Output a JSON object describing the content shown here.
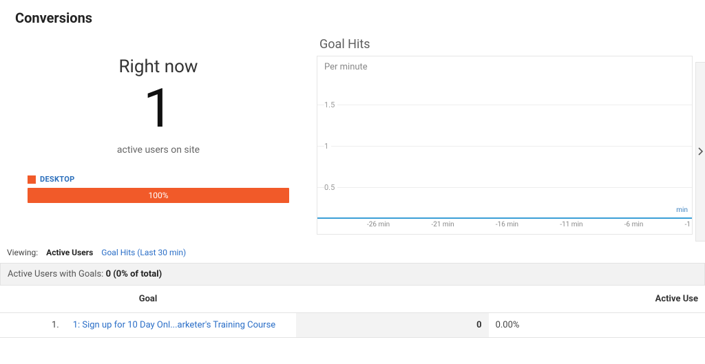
{
  "header": {
    "title": "Conversions"
  },
  "realtime": {
    "heading": "Right now",
    "count": "1",
    "subtitle": "active users on site",
    "device_label": "DESKTOP",
    "device_bar_pct": "100%"
  },
  "chart": {
    "title": "Goal Hits",
    "unit": "Per minute",
    "axis_unit": "min"
  },
  "chart_data": {
    "type": "bar",
    "title": "Goal Hits — Per minute",
    "xlabel": "min",
    "ylabel": "",
    "ylim": [
      0,
      2
    ],
    "yticks": [
      0.5,
      1.0,
      1.5
    ],
    "categories": [
      "-26 min",
      "-21 min",
      "-16 min",
      "-11 min",
      "-6 min",
      "-1"
    ],
    "values": [
      0,
      0,
      0,
      0,
      0,
      0
    ]
  },
  "modes": {
    "label": "Viewing:",
    "active": "Active Users",
    "other": "Goal Hits (Last 30 min)"
  },
  "summary": {
    "prefix": "Active Users with Goals: ",
    "value": "0 (0% of total)"
  },
  "table": {
    "headers": {
      "goal": "Goal",
      "active": "Active Use"
    },
    "rows": [
      {
        "index": "1.",
        "goal": "1: Sign up for 10 Day Onl...arketer's Training Course",
        "count": "0",
        "pct": "0.00%"
      }
    ]
  }
}
